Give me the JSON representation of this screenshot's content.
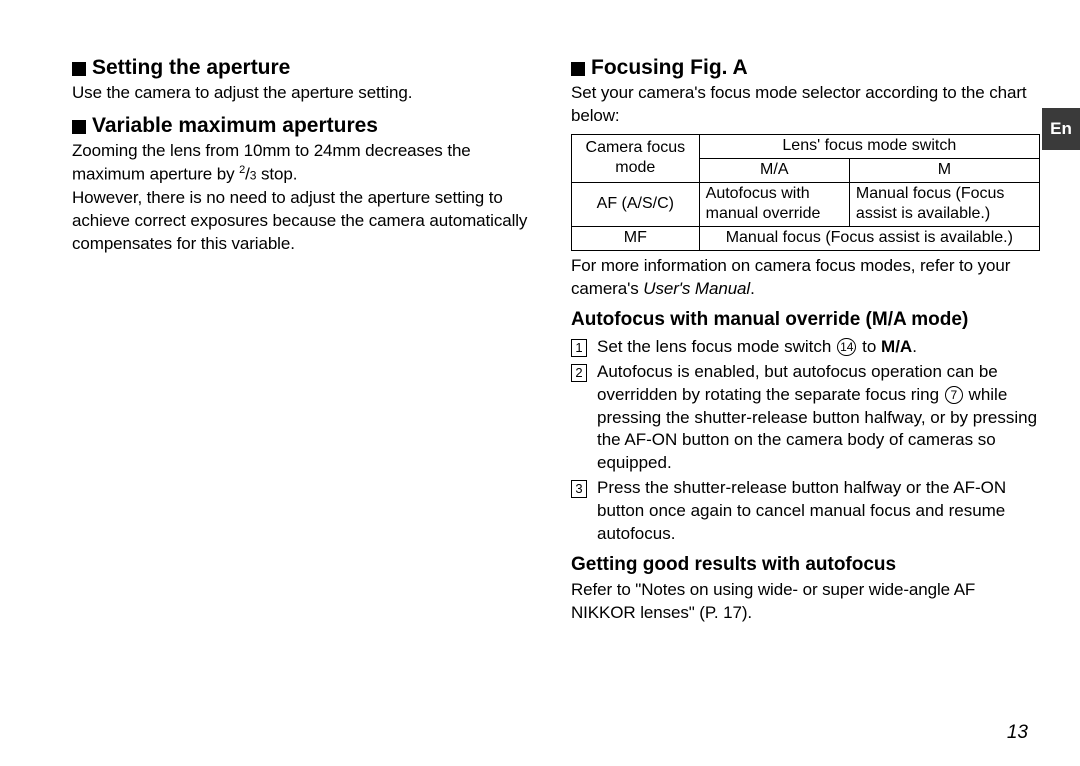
{
  "tab": "En",
  "pagenum": "13",
  "left": {
    "h_aperture": "Setting the aperture",
    "p_aperture": "Use the camera to adjust the aperture setting.",
    "h_varmax": "Variable maximum apertures",
    "p_varmax_1a": "Zooming the lens from 10mm to 24mm decreases the maximum aperture by ",
    "p_varmax_1_frac_num": "2",
    "p_varmax_1_frac_den": "3",
    "p_varmax_1b": " stop.",
    "p_varmax_2": "However, there is no need to adjust the aperture setting to achieve correct exposures because the camera automatically compensates for this variable."
  },
  "right": {
    "h_focus": "Focusing Fig. A",
    "p_focus_intro": "Set your camera's focus mode selector according to the chart below:",
    "table": {
      "r1c1_l1": "Camera focus",
      "r1c1_l2": "mode",
      "r1c2": "Lens' focus mode switch",
      "r2c2": "M/A",
      "r2c3": "M",
      "r3c1": "AF (A/S/C)",
      "r3c2_l1": "Autofocus with",
      "r3c2_l2": "manual override",
      "r3c3_l1": "Manual focus (Focus",
      "r3c3_l2": "assist is available.)",
      "r4c1": "MF",
      "r4c2": "Manual focus (Focus assist is available.)"
    },
    "p_moreinfo_a": "For more information on camera focus modes, refer to your camera's ",
    "p_moreinfo_b": "User's Manual",
    "p_moreinfo_c": ".",
    "h_ma": "Autofocus with manual override (M/A mode)",
    "li1_a": "Set the lens focus mode switch ",
    "li1_ref": "⑭",
    "li1_b": " to ",
    "li1_c": "M/A",
    "li1_d": ".",
    "li2_a": "Autofocus is enabled, but autofocus operation can be overridden by rotating the separate focus ring ",
    "li2_ref": "⑦",
    "li2_b": " while pressing the shutter-release button halfway, or by pressing the AF-ON button on the camera body of cameras so equipped.",
    "li3": "Press the shutter-release button halfway or the AF-ON button once again to cancel manual focus and resume autofocus.",
    "h_good": "Getting good results with autofocus",
    "p_good": "Refer to \"Notes on using wide- or super wide-angle AF NIKKOR lenses\" (P. 17)."
  }
}
